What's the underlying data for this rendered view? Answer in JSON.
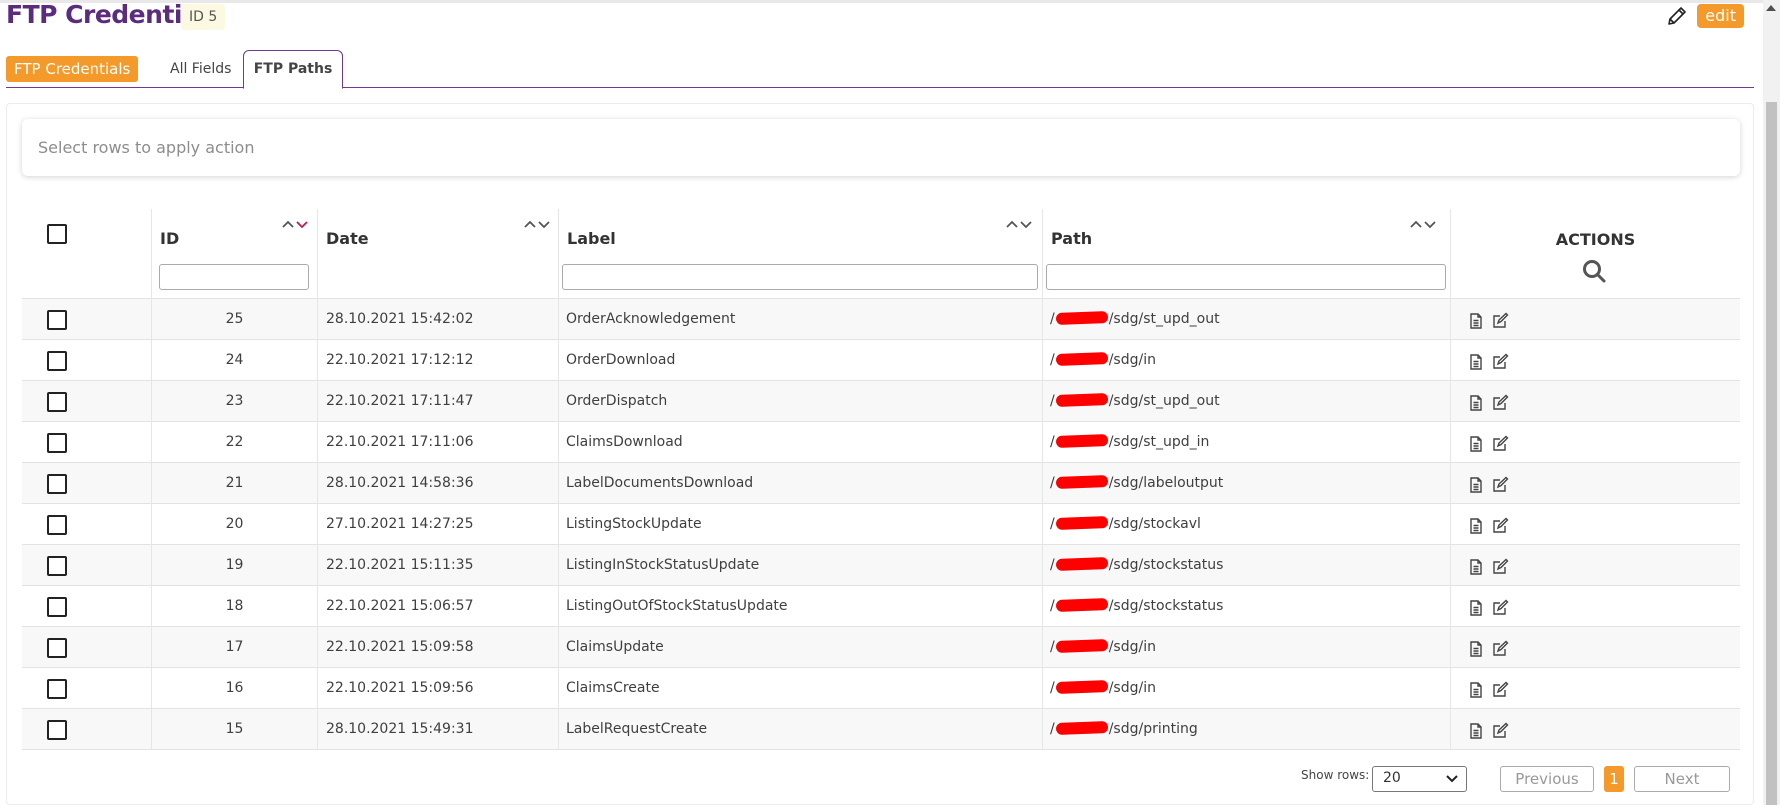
{
  "header": {
    "title": "FTP Credential",
    "id_badge": "ID 5",
    "edit_label": "edit"
  },
  "tabs": [
    {
      "label": "FTP Credentials"
    },
    {
      "label": "All Fields"
    },
    {
      "label": "FTP Paths",
      "active": true
    }
  ],
  "action_bar": {
    "placeholder": "Select rows to apply action"
  },
  "table": {
    "columns": {
      "id": "ID",
      "date": "Date",
      "label": "Label",
      "path": "Path",
      "actions": "ACTIONS"
    },
    "rows": [
      {
        "id": "25",
        "date": "28.10.2021 15:42:02",
        "label": "OrderAcknowledgement",
        "path_prefix": "/",
        "path_suffix": "/sdg/st_upd_out"
      },
      {
        "id": "24",
        "date": "22.10.2021 17:12:12",
        "label": "OrderDownload",
        "path_prefix": "/",
        "path_suffix": "/sdg/in"
      },
      {
        "id": "23",
        "date": "22.10.2021 17:11:47",
        "label": "OrderDispatch",
        "path_prefix": "/",
        "path_suffix": "/sdg/st_upd_out"
      },
      {
        "id": "22",
        "date": "22.10.2021 17:11:06",
        "label": "ClaimsDownload",
        "path_prefix": "/",
        "path_suffix": "/sdg/st_upd_in"
      },
      {
        "id": "21",
        "date": "28.10.2021 14:58:36",
        "label": "LabelDocumentsDownload",
        "path_prefix": "/",
        "path_suffix": "/sdg/labeloutput"
      },
      {
        "id": "20",
        "date": "27.10.2021 14:27:25",
        "label": "ListingStockUpdate",
        "path_prefix": "/",
        "path_suffix": "/sdg/stockavl"
      },
      {
        "id": "19",
        "date": "22.10.2021 15:11:35",
        "label": "ListingInStockStatusUpdate",
        "path_prefix": "/",
        "path_suffix": "/sdg/stockstatus"
      },
      {
        "id": "18",
        "date": "22.10.2021 15:06:57",
        "label": "ListingOutOfStockStatusUpdate",
        "path_prefix": "/",
        "path_suffix": "/sdg/stockstatus"
      },
      {
        "id": "17",
        "date": "22.10.2021 15:09:58",
        "label": "ClaimsUpdate",
        "path_prefix": "/",
        "path_suffix": "/sdg/in"
      },
      {
        "id": "16",
        "date": "22.10.2021 15:09:56",
        "label": "ClaimsCreate",
        "path_prefix": "/",
        "path_suffix": "/sdg/in"
      },
      {
        "id": "15",
        "date": "28.10.2021 15:49:31",
        "label": "LabelRequestCreate",
        "path_prefix": "/",
        "path_suffix": "/sdg/printing"
      }
    ]
  },
  "pagination": {
    "show_rows_label": "Show rows:",
    "rows_value": "20",
    "previous_label": "Previous",
    "current_page": "1",
    "next_label": "Next"
  },
  "colors": {
    "accent": "#f39a2a",
    "brand_purple": "#5b2c7e",
    "redaction": "#ff0000"
  },
  "icons": [
    "pencil-icon",
    "search-icon",
    "document-icon",
    "edit-square-icon",
    "sort-arrows-icon",
    "chevron-down-icon"
  ]
}
